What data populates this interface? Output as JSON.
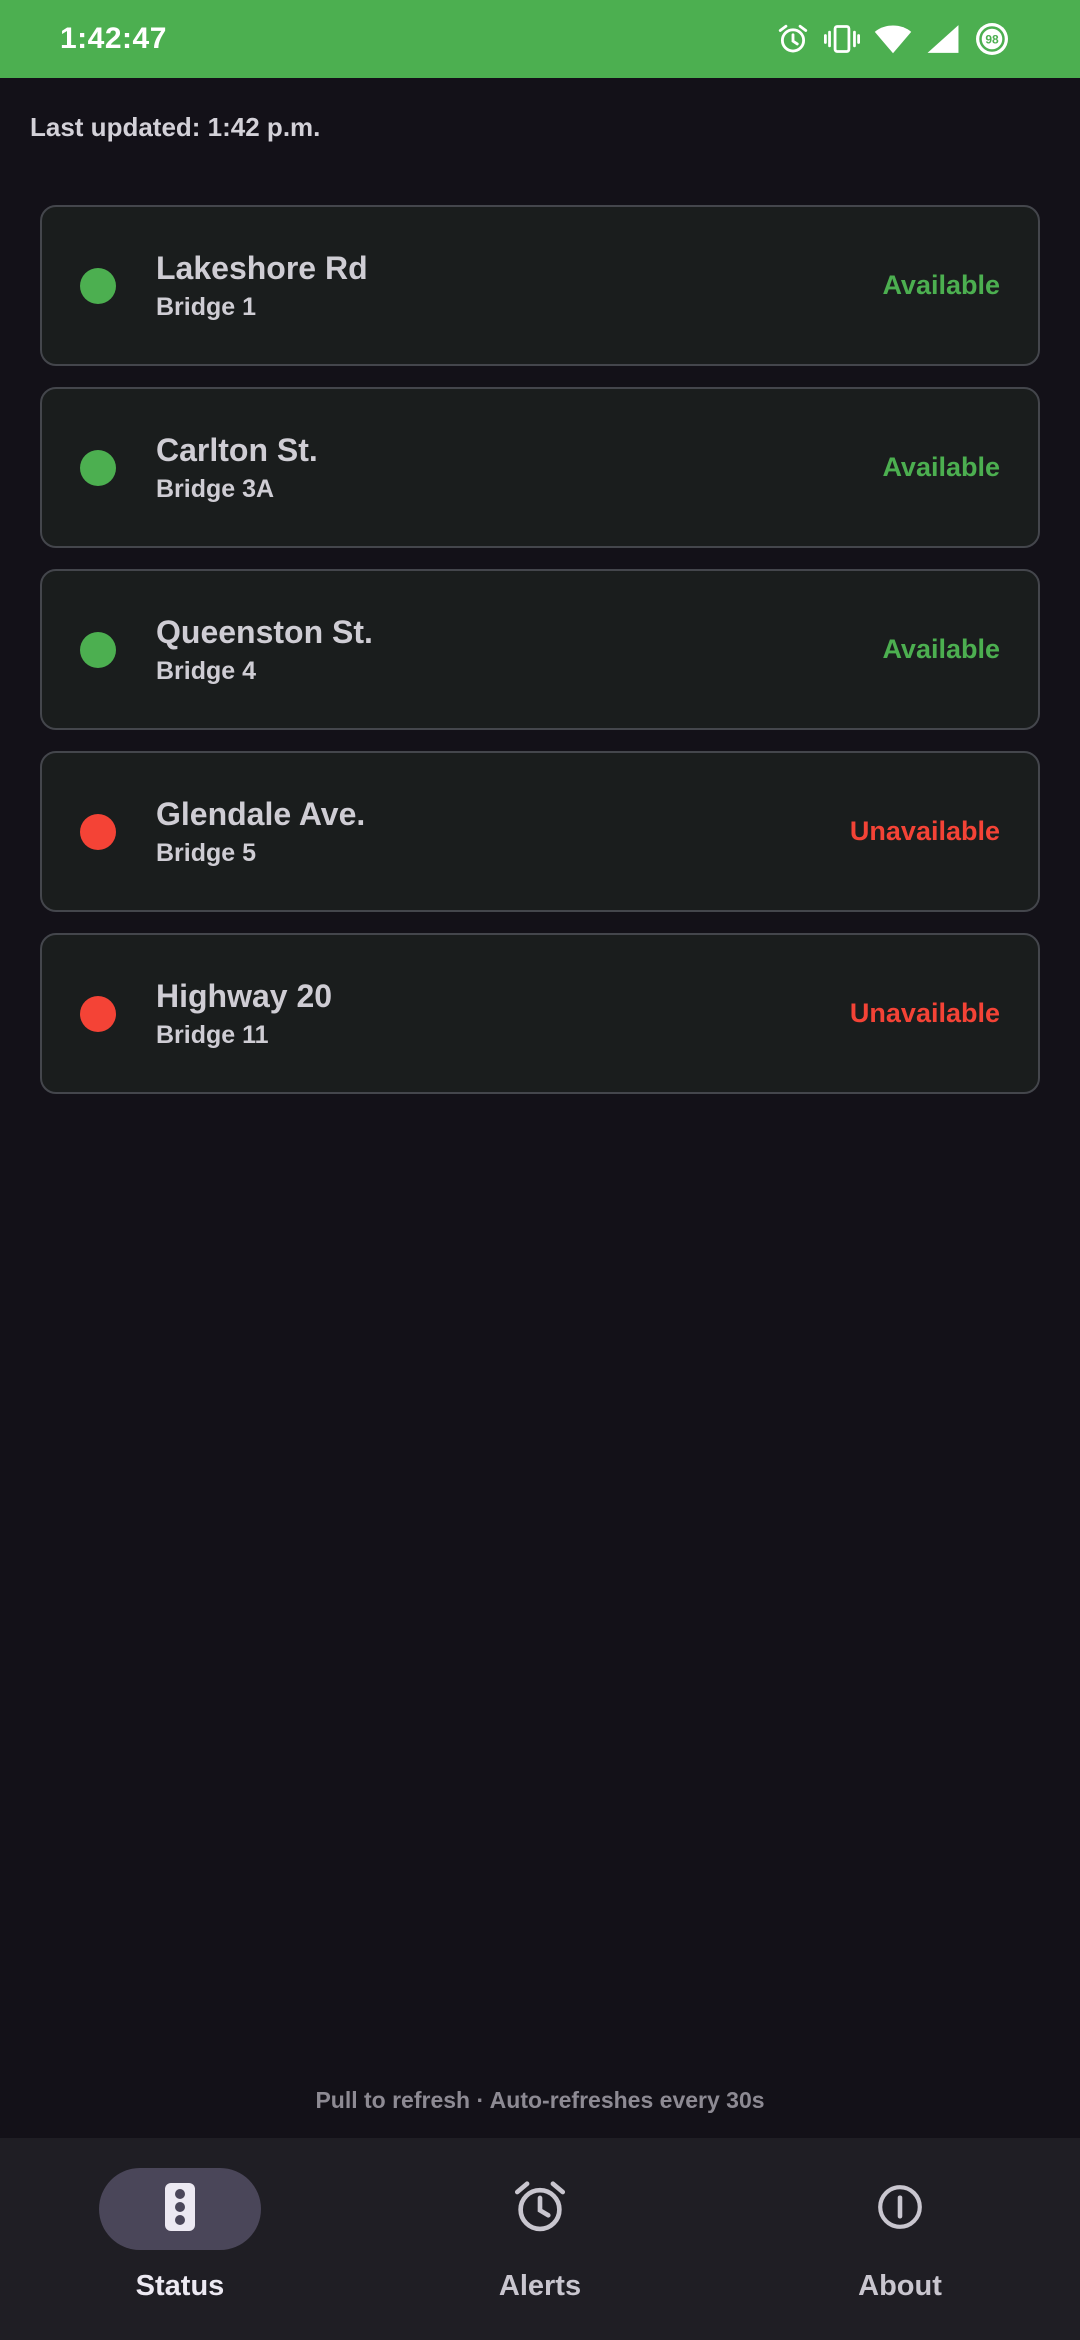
{
  "status_bar": {
    "time": "1:42:47",
    "battery_level": "98",
    "icons": [
      "alarm-icon",
      "vibrate-icon",
      "wifi-icon",
      "cell-signal-icon",
      "battery-icon"
    ],
    "background": "#4caf50"
  },
  "last_updated": "Last updated: 1:42 p.m.",
  "colors": {
    "available": "#4caf50",
    "unavailable": "#f44336"
  },
  "bridges": [
    {
      "name": "Lakeshore Rd",
      "bridge": "Bridge 1",
      "status": "Available",
      "state": "available"
    },
    {
      "name": "Carlton St.",
      "bridge": "Bridge 3A",
      "status": "Available",
      "state": "available"
    },
    {
      "name": "Queenston St.",
      "bridge": "Bridge 4",
      "status": "Available",
      "state": "available"
    },
    {
      "name": "Glendale Ave.",
      "bridge": "Bridge 5",
      "status": "Unavailable",
      "state": "unavailable"
    },
    {
      "name": "Highway 20",
      "bridge": "Bridge 11",
      "status": "Unavailable",
      "state": "unavailable"
    }
  ],
  "refresh_hint": "Pull to refresh · Auto-refreshes every 30s",
  "nav": [
    {
      "label": "Status",
      "icon": "traffic-light-icon",
      "active": true
    },
    {
      "label": "Alerts",
      "icon": "alarm-clock-icon",
      "active": false
    },
    {
      "label": "About",
      "icon": "info-icon",
      "active": false
    }
  ]
}
